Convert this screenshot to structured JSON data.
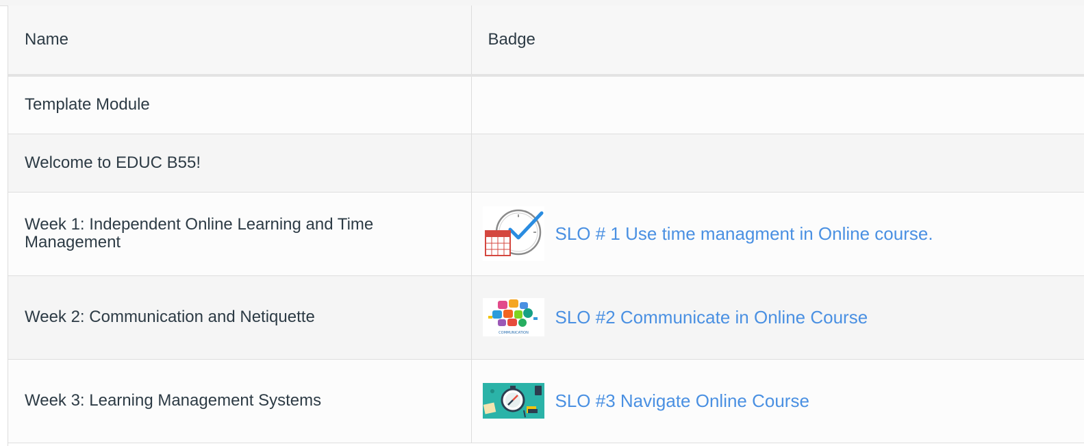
{
  "table": {
    "headers": {
      "name": "Name",
      "badge": "Badge"
    },
    "rows": [
      {
        "name": "Template Module",
        "badge": null
      },
      {
        "name": "Welcome to EDUC B55!",
        "badge": null
      },
      {
        "name": "Week 1: Independent Online Learning and Time Management",
        "badge": {
          "icon": "clock-calendar-icon",
          "link": "SLO # 1 Use time managment in Online course."
        }
      },
      {
        "name": "Week 2: Communication and Netiquette",
        "badge": {
          "icon": "communication-icon",
          "link": "SLO #2 Communicate in Online Course",
          "icon_caption": "COMMUNICATION"
        }
      },
      {
        "name": "Week 3: Learning Management Systems",
        "badge": {
          "icon": "compass-desk-icon",
          "link": "SLO #3 Navigate Online Course"
        }
      }
    ]
  },
  "colors": {
    "link": "#4a90e2",
    "text": "#2d3b45"
  }
}
